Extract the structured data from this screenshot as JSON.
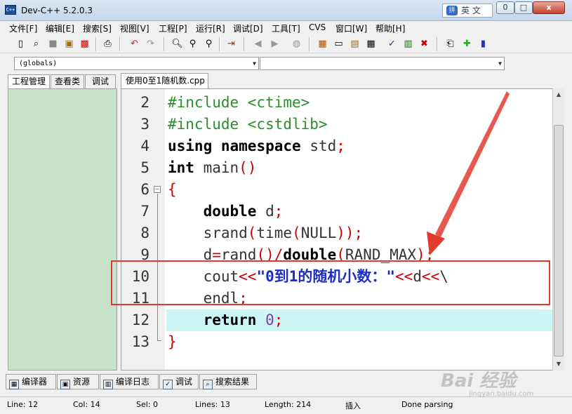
{
  "window": {
    "title": "Dev-C++ 5.2.0.3",
    "ime_label": "英 文",
    "min": "0",
    "max": "□",
    "close": "x"
  },
  "menu": [
    "文件[F]",
    "编辑[E]",
    "搜索[S]",
    "视图[V]",
    "工程[P]",
    "运行[R]",
    "调试[D]",
    "工具[T]",
    "CVS",
    "窗口[W]",
    "帮助[H]"
  ],
  "toolbar_icons": [
    "new-file",
    "open-file",
    "save-file",
    "save-all",
    "close-file",
    "print",
    "undo",
    "redo",
    "find",
    "replace",
    "find-next",
    "goto-line",
    "bookmark-toggle",
    "bookmark-goto",
    "comment",
    "compile",
    "run",
    "compile-run",
    "rebuild",
    "check-syntax",
    "stop",
    "new-project",
    "add-file",
    "remove-file"
  ],
  "combos": {
    "scope": "(globals)",
    "symbol": ""
  },
  "left_tabs": [
    "工程管理",
    "查看类",
    "调试"
  ],
  "editor_tab": "使用0至1随机数.cpp",
  "code": [
    {
      "n": "2",
      "tokens": [
        {
          "t": "#include <ctime>",
          "c": "pre"
        }
      ]
    },
    {
      "n": "3",
      "tokens": [
        {
          "t": "#include <cstdlib>",
          "c": "pre"
        }
      ]
    },
    {
      "n": "4",
      "tokens": [
        {
          "t": "using",
          "c": "kw"
        },
        {
          "t": " ",
          "c": "id"
        },
        {
          "t": "namespace",
          "c": "kw"
        },
        {
          "t": " std",
          "c": "id"
        },
        {
          "t": ";",
          "c": "op"
        }
      ]
    },
    {
      "n": "5",
      "tokens": [
        {
          "t": "int",
          "c": "kw"
        },
        {
          "t": " main",
          "c": "id"
        },
        {
          "t": "()",
          "c": "op"
        }
      ]
    },
    {
      "n": "6",
      "fold": true,
      "tokens": [
        {
          "t": "{",
          "c": "op"
        }
      ]
    },
    {
      "n": "7",
      "tokens": [
        {
          "t": "    ",
          "c": "id"
        },
        {
          "t": "double",
          "c": "kw"
        },
        {
          "t": " d",
          "c": "id"
        },
        {
          "t": ";",
          "c": "op"
        }
      ]
    },
    {
      "n": "8",
      "tokens": [
        {
          "t": "    srand",
          "c": "id"
        },
        {
          "t": "(",
          "c": "op"
        },
        {
          "t": "time",
          "c": "id"
        },
        {
          "t": "(",
          "c": "op"
        },
        {
          "t": "NULL",
          "c": "id"
        },
        {
          "t": "));",
          "c": "op"
        }
      ]
    },
    {
      "n": "9",
      "tokens": [
        {
          "t": "    d",
          "c": "id"
        },
        {
          "t": "=",
          "c": "op"
        },
        {
          "t": "rand",
          "c": "id"
        },
        {
          "t": "()/",
          "c": "op"
        },
        {
          "t": "double",
          "c": "kw"
        },
        {
          "t": "(",
          "c": "op"
        },
        {
          "t": "RAND_MAX",
          "c": "id"
        },
        {
          "t": ");",
          "c": "op"
        }
      ]
    },
    {
      "n": "10",
      "tokens": [
        {
          "t": "    cout",
          "c": "id"
        },
        {
          "t": "<<",
          "c": "op"
        },
        {
          "t": "\"0到1的随机小数：\"",
          "c": "str"
        },
        {
          "t": "<<",
          "c": "op"
        },
        {
          "t": "d",
          "c": "id"
        },
        {
          "t": "<<",
          "c": "op"
        },
        {
          "t": "\\",
          "c": "id"
        }
      ]
    },
    {
      "n": "11",
      "tokens": [
        {
          "t": "    endl",
          "c": "id"
        },
        {
          "t": ";",
          "c": "op"
        }
      ]
    },
    {
      "n": "12",
      "hl": true,
      "tokens": [
        {
          "t": "    ",
          "c": "id"
        },
        {
          "t": "return",
          "c": "kw"
        },
        {
          "t": " ",
          "c": "id"
        },
        {
          "t": "0",
          "c": "num"
        },
        {
          "t": ";",
          "c": "op"
        }
      ]
    },
    {
      "n": "13",
      "foldend": true,
      "tokens": [
        {
          "t": "}",
          "c": "op"
        }
      ]
    }
  ],
  "bottom_tabs": [
    {
      "label": "编译器",
      "icon": "compiler-icon"
    },
    {
      "label": "资源",
      "icon": "resource-icon"
    },
    {
      "label": "编译日志",
      "icon": "compile-log-icon"
    },
    {
      "label": "调试",
      "icon": "debug-icon"
    },
    {
      "label": "搜索结果",
      "icon": "search-results-icon"
    }
  ],
  "status": {
    "line": "Line:   12",
    "col": "Col:   14",
    "sel": "Sel:   0",
    "lines": "Lines:   13",
    "length": "Length:  214",
    "mode": "插入",
    "parse": "Done parsing"
  },
  "watermark": {
    "text": "Bai 经验",
    "sub": "jingyan.baidu.com"
  },
  "colors": {
    "gutter": "#f0f0f0",
    "highlight_line": "#ccf5f5",
    "left_panel": "#c8e2c9",
    "annotation_red": "#e23b2e",
    "string_blue": "#1e2ec0",
    "preprocessor_green": "#2a8f2a"
  }
}
